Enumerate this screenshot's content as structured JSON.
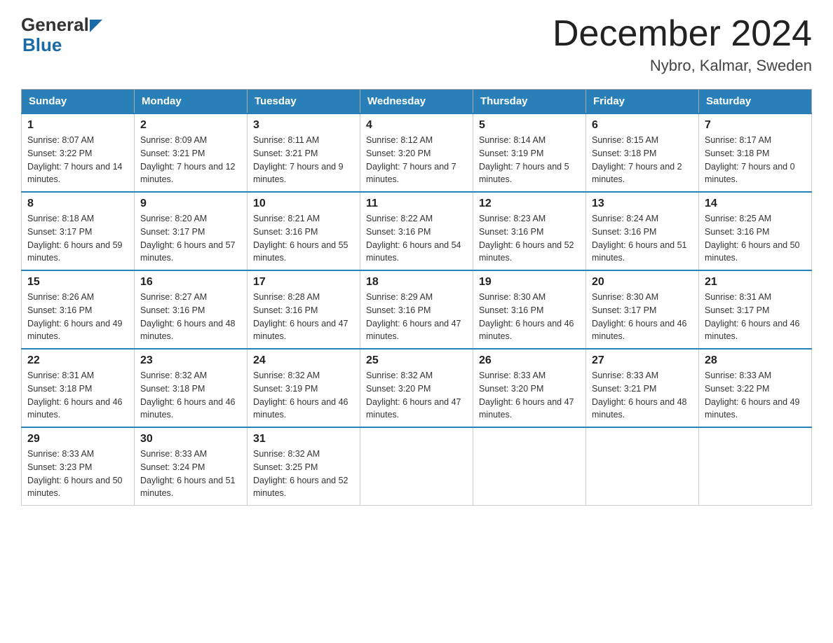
{
  "header": {
    "month_year": "December 2024",
    "location": "Nybro, Kalmar, Sweden",
    "logo_general": "General",
    "logo_blue": "Blue"
  },
  "days_of_week": [
    "Sunday",
    "Monday",
    "Tuesday",
    "Wednesday",
    "Thursday",
    "Friday",
    "Saturday"
  ],
  "weeks": [
    [
      {
        "day": "1",
        "sunrise": "8:07 AM",
        "sunset": "3:22 PM",
        "daylight": "7 hours and 14 minutes."
      },
      {
        "day": "2",
        "sunrise": "8:09 AM",
        "sunset": "3:21 PM",
        "daylight": "7 hours and 12 minutes."
      },
      {
        "day": "3",
        "sunrise": "8:11 AM",
        "sunset": "3:21 PM",
        "daylight": "7 hours and 9 minutes."
      },
      {
        "day": "4",
        "sunrise": "8:12 AM",
        "sunset": "3:20 PM",
        "daylight": "7 hours and 7 minutes."
      },
      {
        "day": "5",
        "sunrise": "8:14 AM",
        "sunset": "3:19 PM",
        "daylight": "7 hours and 5 minutes."
      },
      {
        "day": "6",
        "sunrise": "8:15 AM",
        "sunset": "3:18 PM",
        "daylight": "7 hours and 2 minutes."
      },
      {
        "day": "7",
        "sunrise": "8:17 AM",
        "sunset": "3:18 PM",
        "daylight": "7 hours and 0 minutes."
      }
    ],
    [
      {
        "day": "8",
        "sunrise": "8:18 AM",
        "sunset": "3:17 PM",
        "daylight": "6 hours and 59 minutes."
      },
      {
        "day": "9",
        "sunrise": "8:20 AM",
        "sunset": "3:17 PM",
        "daylight": "6 hours and 57 minutes."
      },
      {
        "day": "10",
        "sunrise": "8:21 AM",
        "sunset": "3:16 PM",
        "daylight": "6 hours and 55 minutes."
      },
      {
        "day": "11",
        "sunrise": "8:22 AM",
        "sunset": "3:16 PM",
        "daylight": "6 hours and 54 minutes."
      },
      {
        "day": "12",
        "sunrise": "8:23 AM",
        "sunset": "3:16 PM",
        "daylight": "6 hours and 52 minutes."
      },
      {
        "day": "13",
        "sunrise": "8:24 AM",
        "sunset": "3:16 PM",
        "daylight": "6 hours and 51 minutes."
      },
      {
        "day": "14",
        "sunrise": "8:25 AM",
        "sunset": "3:16 PM",
        "daylight": "6 hours and 50 minutes."
      }
    ],
    [
      {
        "day": "15",
        "sunrise": "8:26 AM",
        "sunset": "3:16 PM",
        "daylight": "6 hours and 49 minutes."
      },
      {
        "day": "16",
        "sunrise": "8:27 AM",
        "sunset": "3:16 PM",
        "daylight": "6 hours and 48 minutes."
      },
      {
        "day": "17",
        "sunrise": "8:28 AM",
        "sunset": "3:16 PM",
        "daylight": "6 hours and 47 minutes."
      },
      {
        "day": "18",
        "sunrise": "8:29 AM",
        "sunset": "3:16 PM",
        "daylight": "6 hours and 47 minutes."
      },
      {
        "day": "19",
        "sunrise": "8:30 AM",
        "sunset": "3:16 PM",
        "daylight": "6 hours and 46 minutes."
      },
      {
        "day": "20",
        "sunrise": "8:30 AM",
        "sunset": "3:17 PM",
        "daylight": "6 hours and 46 minutes."
      },
      {
        "day": "21",
        "sunrise": "8:31 AM",
        "sunset": "3:17 PM",
        "daylight": "6 hours and 46 minutes."
      }
    ],
    [
      {
        "day": "22",
        "sunrise": "8:31 AM",
        "sunset": "3:18 PM",
        "daylight": "6 hours and 46 minutes."
      },
      {
        "day": "23",
        "sunrise": "8:32 AM",
        "sunset": "3:18 PM",
        "daylight": "6 hours and 46 minutes."
      },
      {
        "day": "24",
        "sunrise": "8:32 AM",
        "sunset": "3:19 PM",
        "daylight": "6 hours and 46 minutes."
      },
      {
        "day": "25",
        "sunrise": "8:32 AM",
        "sunset": "3:20 PM",
        "daylight": "6 hours and 47 minutes."
      },
      {
        "day": "26",
        "sunrise": "8:33 AM",
        "sunset": "3:20 PM",
        "daylight": "6 hours and 47 minutes."
      },
      {
        "day": "27",
        "sunrise": "8:33 AM",
        "sunset": "3:21 PM",
        "daylight": "6 hours and 48 minutes."
      },
      {
        "day": "28",
        "sunrise": "8:33 AM",
        "sunset": "3:22 PM",
        "daylight": "6 hours and 49 minutes."
      }
    ],
    [
      {
        "day": "29",
        "sunrise": "8:33 AM",
        "sunset": "3:23 PM",
        "daylight": "6 hours and 50 minutes."
      },
      {
        "day": "30",
        "sunrise": "8:33 AM",
        "sunset": "3:24 PM",
        "daylight": "6 hours and 51 minutes."
      },
      {
        "day": "31",
        "sunrise": "8:32 AM",
        "sunset": "3:25 PM",
        "daylight": "6 hours and 52 minutes."
      },
      null,
      null,
      null,
      null
    ]
  ],
  "labels": {
    "sunrise": "Sunrise:",
    "sunset": "Sunset:",
    "daylight": "Daylight:"
  }
}
